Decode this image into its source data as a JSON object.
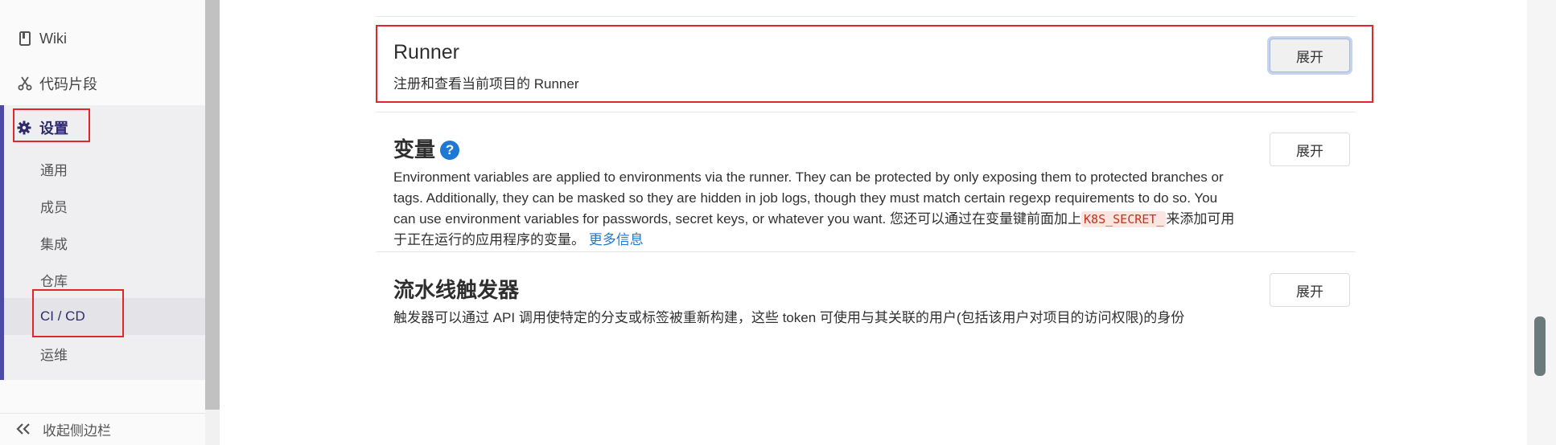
{
  "sidebar": {
    "wiki": "Wiki",
    "snippets": "代码片段",
    "settings": "设置",
    "sub_items": [
      "通用",
      "成员",
      "集成",
      "仓库",
      "CI / CD",
      "运维"
    ],
    "collapse": "收起侧边栏"
  },
  "sections": {
    "runner": {
      "title": "Runner",
      "desc": "注册和查看当前项目的 Runner",
      "button": "展开"
    },
    "variables": {
      "title": "变量",
      "help": "?",
      "desc_part1": "Environment variables are applied to environments via the runner. They can be protected by only exposing them to protected branches or tags. Additionally, they can be masked so they are hidden in job logs, though they must match certain regexp requirements to do so. You can use environment variables for passwords, secret keys, or whatever you want. 您还可以通过在变量键前面加上",
      "code": "K8S_SECRET_",
      "desc_part2": "来添加可用于正在运行的应用程序的变量。",
      "more_link": "更多信息",
      "button": "展开"
    },
    "triggers": {
      "title": "流水线触发器",
      "desc": "触发器可以通过 API 调用使特定的分支或标签被重新构建，这些 token 可使用与其关联的用户(包括该用户对项目的访问权限)的身份",
      "button": "展开"
    }
  },
  "colors": {
    "accent": "#4b4ba3",
    "highlight": "#e3262c",
    "link": "#1f78d1"
  }
}
